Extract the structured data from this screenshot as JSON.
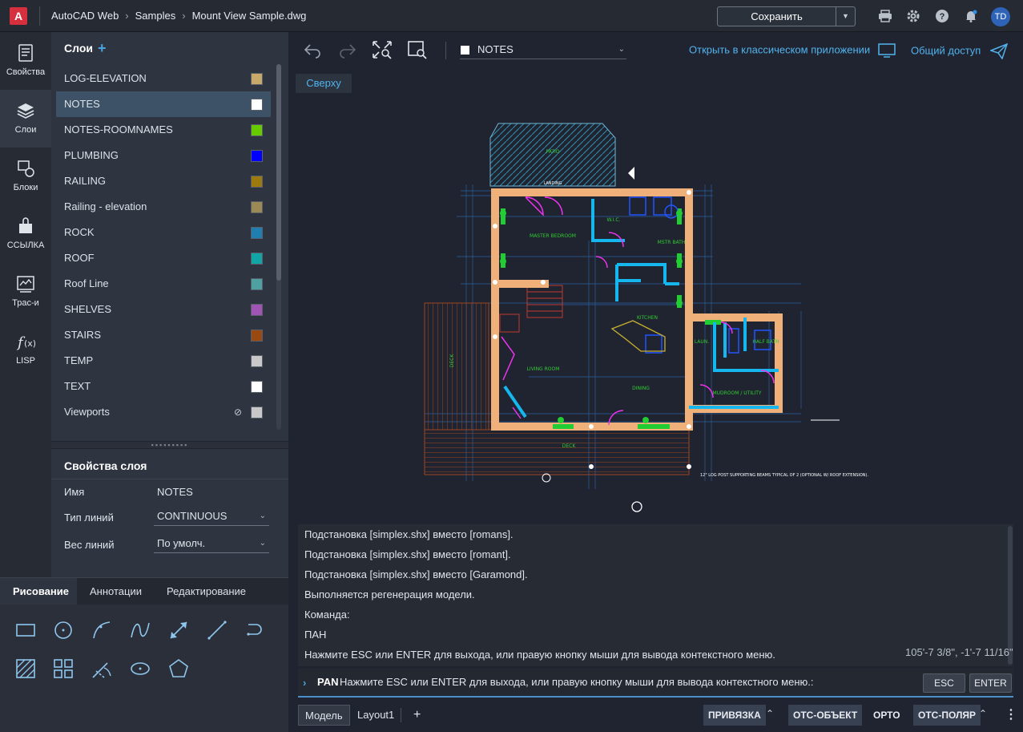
{
  "app": {
    "logo_letter": "A",
    "name": "AutoCAD Web"
  },
  "breadcrumb": {
    "items": [
      "Samples",
      "Mount View Sample.dwg"
    ]
  },
  "header": {
    "save_label": "Сохранить",
    "avatar_initials": "TD"
  },
  "rail": {
    "items": [
      {
        "label": "Свойства",
        "icon": "properties-icon"
      },
      {
        "label": "Слои",
        "icon": "layers-icon",
        "active": true
      },
      {
        "label": "Блоки",
        "icon": "blocks-icon"
      },
      {
        "label": "ССЫЛКА",
        "icon": "xref-icon"
      },
      {
        "label": "Трас-и",
        "icon": "trace-icon"
      },
      {
        "label": "LISP",
        "icon": "lisp-icon"
      }
    ]
  },
  "layers": {
    "title": "Слои",
    "add_symbol": "+",
    "items": [
      {
        "name": "LOG-ELEVATION",
        "color": "#c9a96a"
      },
      {
        "name": "NOTES",
        "color": "#ffffff",
        "selected": true
      },
      {
        "name": "NOTES-ROOMNAMES",
        "color": "#66cc00"
      },
      {
        "name": "PLUMBING",
        "color": "#0000ff"
      },
      {
        "name": "RAILING",
        "color": "#9c7a10"
      },
      {
        "name": "Railing - elevation",
        "color": "#9c8a56"
      },
      {
        "name": "ROCK",
        "color": "#1e7fb0"
      },
      {
        "name": "ROOF",
        "color": "#12a5a5"
      },
      {
        "name": "Roof Line",
        "color": "#4fa0a0"
      },
      {
        "name": "SHELVES",
        "color": "#a055b5"
      },
      {
        "name": "STAIRS",
        "color": "#9a4a10"
      },
      {
        "name": "TEMP",
        "color": "#c8c8c8"
      },
      {
        "name": "TEXT",
        "color": "#ffffff"
      },
      {
        "name": "Viewports",
        "color": "#c8c8c8",
        "locked": true
      }
    ]
  },
  "layer_props": {
    "title": "Свойства слоя",
    "name_label": "Имя",
    "name_value": "NOTES",
    "linetype_label": "Тип линий",
    "linetype_value": "CONTINUOUS",
    "lineweight_label": "Вес линий",
    "lineweight_value": "По умолч."
  },
  "draw_panel": {
    "tabs": [
      "Рисование",
      "Аннотации",
      "Редактирование"
    ],
    "tools": [
      "rectangle-tool-icon",
      "circle-tool-icon",
      "arc-tool-icon",
      "spline-tool-icon",
      "dimension-tool-icon",
      "line-tool-icon",
      "polyline-tool-icon",
      "hatch-tool-icon",
      "array-tool-icon",
      "trim-tool-icon",
      "ellipse-tool-icon",
      "polygon-tool-icon"
    ]
  },
  "toolbar": {
    "current_layer": "NOTES",
    "open_classic": "Открыть в классическом приложении",
    "share": "Общий доступ"
  },
  "view": {
    "label": "Сверху"
  },
  "command": {
    "history": [
      "Подстановка [simplex.shx] вместо [romans].",
      "Подстановка [simplex.shx] вместо [romant].",
      "Подстановка [simplex.shx] вместо [Garamond].",
      "Выполняется регенерация модели.",
      "Команда:",
      "ПАН",
      "Нажмите ESC или ENTER для выхода, или правую кнопку мыши для вывода контекстного меню."
    ],
    "coords": "105'-7 3/8\", -1'-7 11/16\"",
    "current_cmd": "PAN",
    "prompt": "Нажмите ESC или ENTER для выхода, или правую кнопку мыши для вывода контекстного меню.:",
    "esc_label": "ESC",
    "enter_label": "ENTER"
  },
  "status": {
    "model_tab": "Модель",
    "layout_tab": "Layout1",
    "add_tab": "+",
    "snap": "ПРИВЯЗКА",
    "otrack": "ОТС-ОБЪЕКТ",
    "ortho": "ОРТО",
    "polar": "ОТС-ПОЛЯР"
  },
  "plan": {
    "labels": [
      "PATIO",
      "LANDING",
      "MASTER BEDROOM",
      "W.I.C.",
      "MSTR BATH",
      "KITCHEN",
      "LIVING ROOM",
      "DINING",
      "LAUN.",
      "HALF BATH",
      "MUDROOM / UTILITY",
      "DECK",
      "DECK"
    ],
    "note": "12\" LOG POST SUPPORTING BEAMS TYPICAL OF 2 (OPTIONAL W/ ROOF EXTENSION)."
  }
}
